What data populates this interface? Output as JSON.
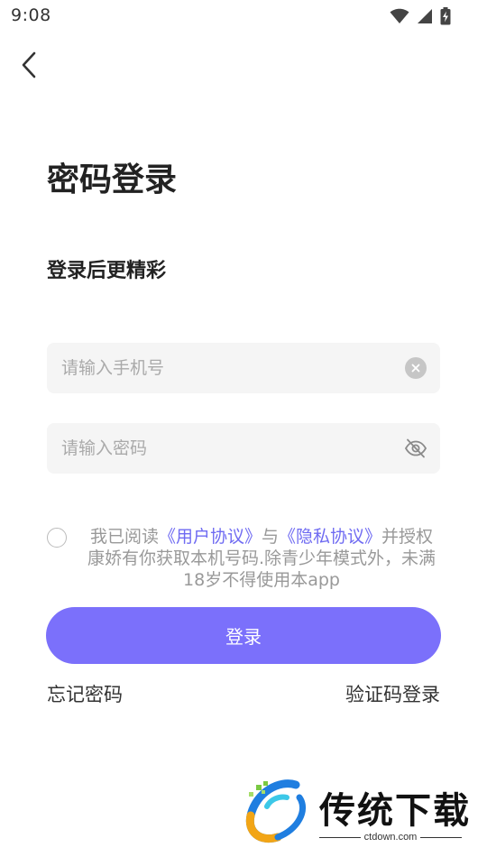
{
  "status_bar": {
    "time": "9:08",
    "icons": [
      "wifi-icon",
      "cellular-signal-icon",
      "battery-charging-icon"
    ]
  },
  "header": {
    "back_icon": "chevron-left-icon"
  },
  "main": {
    "title": "密码登录",
    "subtitle": "登录后更精彩",
    "phone_input": {
      "value": "",
      "placeholder": "请输入手机号",
      "clear_icon": "clear-icon"
    },
    "password_input": {
      "value": "",
      "placeholder": "请输入密码",
      "visibility_icon": "eye-off-icon"
    },
    "agreement": {
      "checked": false,
      "text_before": "我已阅读",
      "user_agreement": "《用户协议》",
      "connector": "与",
      "privacy_policy": "《隐私协议》",
      "text_after": "并授权康娇有你获取本机号码.除青少年模式外，未满18岁不得使用本app"
    },
    "login_button": "登录",
    "forgot_password": "忘记密码",
    "code_login": "验证码登录"
  },
  "watermark": {
    "title": "传统下载",
    "url": "ctdown.com"
  },
  "colors": {
    "accent": "#7b70fb",
    "link": "#6f6bf2",
    "input_bg": "#f5f5f5",
    "placeholder": "#aaaaaa"
  }
}
